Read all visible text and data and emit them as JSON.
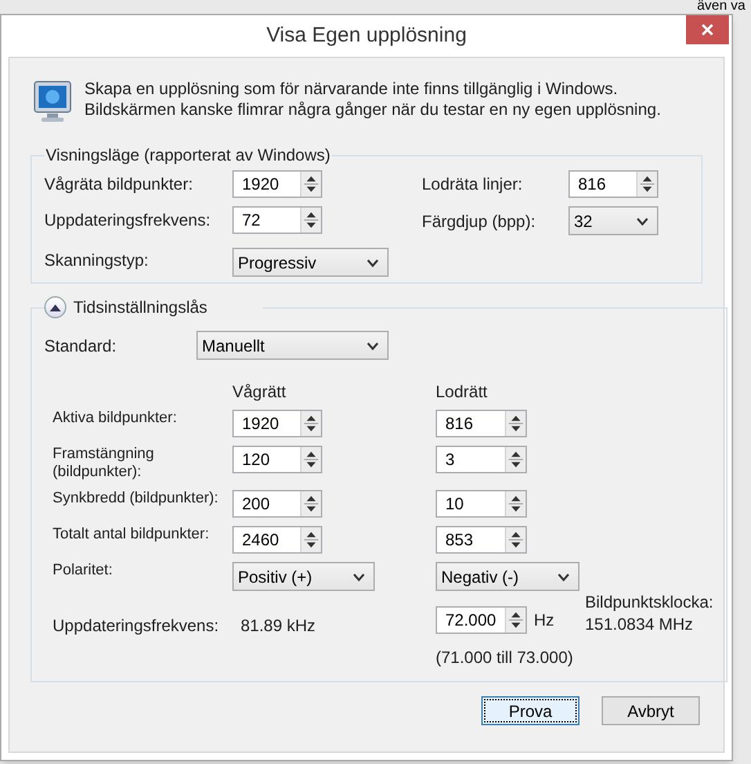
{
  "background_text": "även va",
  "window": {
    "title": "Visa Egen upplösning"
  },
  "info": "Skapa en upplösning som för närvarande inte finns tillgänglig i Windows. Bildskärmen kanske flimrar några gånger när du testar en ny egen upplösning.",
  "display_mode": {
    "legend": "Visningsläge (rapporterat av Windows)",
    "left": [
      {
        "label": "Vågräta bildpunkter:",
        "kind": "spin",
        "value": "1920"
      },
      {
        "label": "Uppdateringsfrekvens:",
        "kind": "spin",
        "value": "72"
      },
      {
        "label": "Skanningstyp:",
        "kind": "select",
        "value": "Progressiv"
      }
    ],
    "right": [
      {
        "label": "Lodräta linjer:",
        "kind": "spin",
        "value": "816"
      },
      {
        "label": "Färgdjup (bpp):",
        "kind": "select",
        "value": "32"
      }
    ]
  },
  "timing": {
    "legend": "Tidsinställningslås",
    "expanded": true,
    "standard_label": "Standard:",
    "standard_value": "Manuellt",
    "col_headers": [
      "Vågrätt",
      "Lodrätt"
    ],
    "rows": [
      {
        "label": "Aktiva bildpunkter:",
        "kind": "spin",
        "h": "1920",
        "v": "816"
      },
      {
        "label": "Framstängning (bildpunkter):",
        "kind": "spin",
        "h": "120",
        "v": "3"
      },
      {
        "label": "Synkbredd (bildpunkter):",
        "kind": "spin",
        "h": "200",
        "v": "10"
      },
      {
        "label": "Totalt antal bildpunkter:",
        "kind": "spin",
        "h": "2460",
        "v": "853"
      },
      {
        "label": "Polaritet:",
        "kind": "select",
        "h": "Positiv (+)",
        "v": "Negativ (-)"
      }
    ],
    "refresh_label": "Uppdateringsfrekvens:",
    "refresh_h": "81.89 kHz",
    "refresh_v": "72.000",
    "refresh_unit": "Hz",
    "range": "(71.000 till 73.000)",
    "clock_label": "Bildpunktsklocka:",
    "clock_value": "151.0834 MHz"
  },
  "buttons": [
    {
      "label": "Prova",
      "focused": true
    },
    {
      "label": "Avbryt",
      "focused": false
    }
  ]
}
